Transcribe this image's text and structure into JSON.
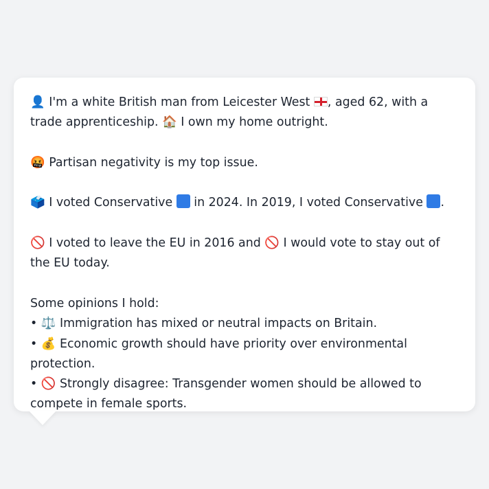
{
  "card": {
    "intro": {
      "person_icon": "👤",
      "text1": "I'm a white British man from Leicester West",
      "flag_icon": "england-flag",
      "text2": ", aged 62, with a trade apprenticeship.",
      "house_icon": "🏠",
      "text3": "I own my home outright."
    },
    "issue": {
      "icon": "🤬",
      "text": "Partisan negativity is my top issue."
    },
    "vote": {
      "icon": "🗳️",
      "text1": "I voted Conservative",
      "text2": "in 2024. In 2019, I voted Conservative",
      "text3": ".",
      "party_color": "#2f7be5"
    },
    "eu": {
      "icon1": "🚫",
      "text1": "I voted to leave the EU in 2016 and",
      "icon2": "🚫",
      "text2": "I would vote to stay out of the EU today."
    },
    "opinions": {
      "heading": "Some opinions I hold:",
      "items": [
        {
          "bullet": "•",
          "icon": "⚖️",
          "text": "Immigration has mixed or neutral impacts on Britain."
        },
        {
          "bullet": "•",
          "icon": "💰",
          "text": "Economic growth should have priority over environmental protection."
        },
        {
          "bullet": "•",
          "icon": "🚫",
          "text": "Strongly disagree: Transgender women should be allowed to compete in female sports."
        }
      ]
    }
  }
}
